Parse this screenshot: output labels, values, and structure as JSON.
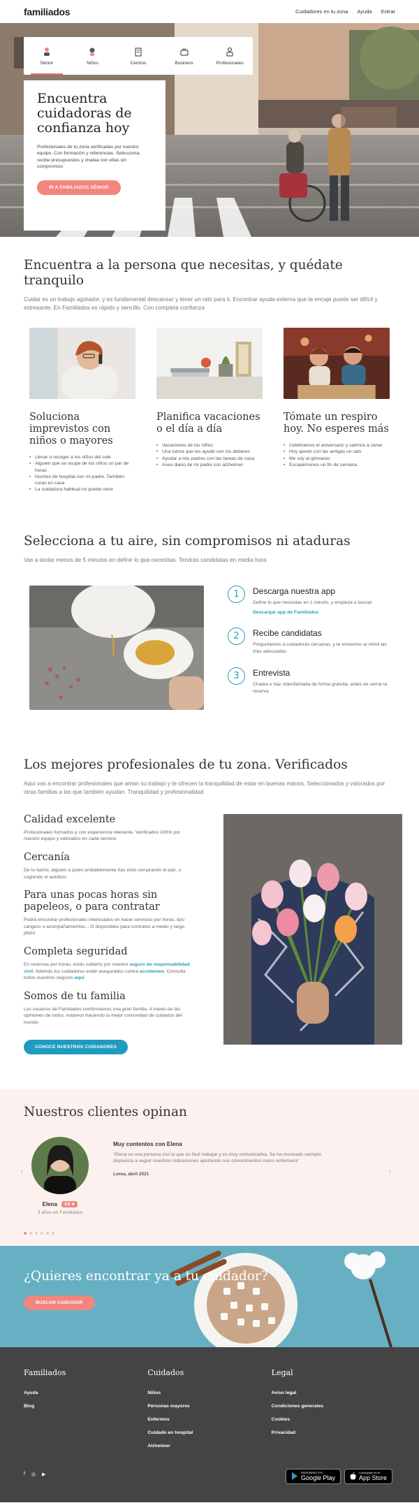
{
  "header": {
    "logo": "familiados",
    "nav": [
      "Cuidadores en tu zona",
      "Ayuda",
      "Entrar"
    ]
  },
  "hero": {
    "tabs": [
      {
        "label": "Sénior",
        "icon": "elderly-icon"
      },
      {
        "label": "Niños",
        "icon": "child-icon"
      },
      {
        "label": "Centros",
        "icon": "building-icon"
      },
      {
        "label": "Business",
        "icon": "briefcase-icon"
      },
      {
        "label": "Profesionales",
        "icon": "professional-icon"
      }
    ],
    "title": "Encuentra cuidadoras de confianza hoy",
    "description": "Profesionales de tu zona verificadas por nuestro equipo. Con formación y referencias. Selecciona, recibe presupuestos y chatea con ellas sin compromiso",
    "button": "IR A FAMILIADOS SÉNIOR"
  },
  "section1": {
    "title": "Encuentra a la persona que necesitas, y quédate tranquilo",
    "lead": "Cuidar es un trabajo agotador, y es fundamental descansar y tener un rato para ti. Encontrar ayuda externa que te encaje puede ser difícil y estresante. En Familiados es rápido y sencillo. Con completa confianza",
    "cards": [
      {
        "title": "Soluciona imprevistos con niños o mayores",
        "items": [
          "Llevar o recoger a los niños del cole",
          "Alguien que se ocupe de los niños un par de horas",
          "Noches de hospital con mi padre. También curas en casa",
          "La cuidadora habitual no puede venir"
        ]
      },
      {
        "title": "Planifica vacaciones o el día a día",
        "items": [
          "Vacaciones de los niños",
          "Una tutora que les ayude con los deberes",
          "Ayudar a mis padres con las tareas de casa",
          "Aseo diario de mi padre con alzheimer"
        ]
      },
      {
        "title": "Tómate un respiro hoy. No esperes más",
        "items": [
          "Celebramos el aniversario y salimos a cenar",
          "Hoy quedo con las amigas un rato",
          "Me voy al gimnasio",
          "Escapémonos un fin de semana"
        ]
      }
    ]
  },
  "section2": {
    "title": "Selecciona a tu aire, sin compromisos ni ataduras",
    "lead": "Vas a tardar menos de 5 minutos en definir lo que necesitas. Tendrás candidatas en media hora",
    "steps": [
      {
        "num": "1",
        "title": "Descarga nuestra app",
        "text": "Define lo que necesitas en 1 minuto, y empieza a buscar",
        "link": "Descargar app de Familiados"
      },
      {
        "num": "2",
        "title": "Recibe candidatas",
        "text": "Preguntamos a cuidadoras cercanas, y te enviamos al móvil las más adecuadas"
      },
      {
        "num": "3",
        "title": "Entrevista",
        "text": "Chatea o haz videollamada de forma gratuita, antes de cerrar la reserva"
      }
    ]
  },
  "section3": {
    "title": "Los mejores profesionales de tu zona. Verificados",
    "lead": "Aquí vas a encontrar profesionales que aman su trabajo y te ofrecen la tranquilidad de estar en buenas manos. Seleccionados y valorados por otras familias a las que también ayudan. Tranquilidad y profesionalidad",
    "features": [
      {
        "title": "Calidad excelente",
        "text": "Profesionales formados y con experiencia relevante. Verificados 100% por nuestro equipo y valorados en cada servicio"
      },
      {
        "title": "Cercanía",
        "text": "De tu barrio, alguien a quien probablemente has visto comprando el pan, o cogiendo el autobús"
      },
      {
        "title": "Para unas pocas horas sin papeleos, o para contratar",
        "text": "Podrá encontrar profesionales interesados en hacer servicios por horas, tipo canguro o acompañamientos... O disponibles para contratos a medio y largo plazo"
      },
      {
        "title": "Completa seguridad",
        "text_a": "En reservas por horas, estás cubierto por nuestro ",
        "link_a": "seguro de responsabilidad civil",
        "text_b": ". Además los cuidadores están asegurados contra ",
        "link_b": "accidentes",
        "text_c": ". Consulta todos nuestros seguros ",
        "link_c": "aquí"
      },
      {
        "title": "Somos de tu familia",
        "text": "Los usuarios de Familiados conformamos una gran familia. A través de las opiniones de todos, estamos haciendo la mejor comunidad de cuidados del mundo"
      }
    ],
    "button": "CONOCE NUESTROS CUIDADORES"
  },
  "testimonials": {
    "title": "Nuestros clientes opinan",
    "name": "Elena",
    "rating": "4,8 ★",
    "since": "3 años en Familiados",
    "quote_title": "Muy contentos con Elena",
    "quote": "“Elena es una persona con la que es fácil trabajar y es muy comunicativa. Se ha mostrado siempre dispuesta a seguir nuestras indicaciones aportando sus conocimientos como enfermera”",
    "author": "Lorea, abril 2021",
    "prev": "‹",
    "next": "›"
  },
  "banner": {
    "title": "¿Quieres encontrar ya a tu cuidador?",
    "button": "BUSCAR CUIDADOR"
  },
  "footer": {
    "cols": [
      {
        "title": "Familiados",
        "links": [
          "Ayuda",
          "Blog"
        ]
      },
      {
        "title": "Cuidados",
        "links": [
          "Niños",
          "Personas mayores",
          "Enfermos",
          "Cuidado en hospital",
          "Alzheimer"
        ]
      },
      {
        "title": "Legal",
        "links": [
          "Aviso legal",
          "Condiciones generales",
          "Cookies",
          "Privacidad"
        ]
      }
    ],
    "social": [
      "f",
      "◎",
      "▶"
    ],
    "google_top": "DISPONIBLE EN",
    "google_name": "Google Play",
    "apple_top": "Consíguelo en el",
    "apple_name": "App Store"
  },
  "colors": {
    "accent": "#f2857d",
    "blue": "#1e9bbf",
    "footer": "#444444",
    "testimonial_bg": "#fcf1ef"
  }
}
